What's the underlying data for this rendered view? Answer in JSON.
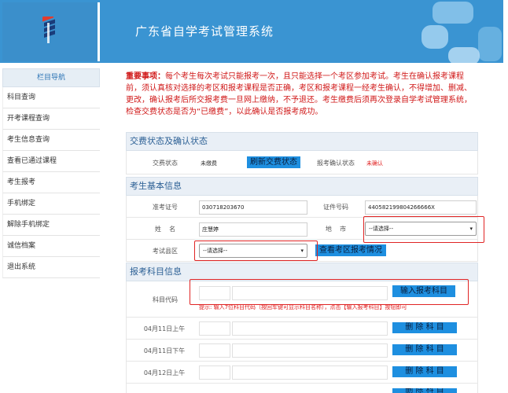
{
  "header": {
    "title": "广东省自学考试管理系统"
  },
  "sidebar": {
    "title": "栏目导航",
    "items": [
      {
        "label": "科目查询"
      },
      {
        "label": "开考课程查询"
      },
      {
        "label": "考生信息查询"
      },
      {
        "label": "查看已通过课程"
      },
      {
        "label": "考生报考"
      },
      {
        "label": "手机绑定"
      },
      {
        "label": "解除手机绑定"
      },
      {
        "label": "诚信档案"
      },
      {
        "label": "退出系统"
      }
    ]
  },
  "notice": {
    "heading": "重要事项：",
    "text": "每个考生每次考试只能报考一次，且只能选择一个考区参加考试。考生在确认报考课程前，须认真核对选择的考区和报考课程是否正确，考区和报考课程一经考生确认，不得增加、删减、更改，确认报考后所交报考费一旦网上缴纳，不予退还。考生缴费后须再次登录自学考试管理系统，检查交费状态是否为“已缴费”，以此确认是否报考成功。"
  },
  "payment": {
    "section_title": "交费状态及确认状态",
    "status_label": "交费状态",
    "status_value": "未缴费",
    "refresh_button": "刷新交费状态",
    "confirm_label": "报考确认状态",
    "confirm_value": "未确认"
  },
  "basic": {
    "section_title": "考生基本信息",
    "exam_no_label": "准考证号",
    "exam_no_value": "030718203670",
    "id_label": "证件号码",
    "id_value": "440582199804266666X",
    "name_label": "姓    名",
    "name_value": "庄慧婷",
    "city_label": "地    市",
    "city_placeholder": "--请选择--",
    "district_label": "考试县区",
    "district_placeholder": "--请选择--",
    "view_district_button": "查看考区报考情况"
  },
  "subjects": {
    "section_title": "报考科目信息",
    "code_label": "科目代码",
    "input_button": "输入报考科目",
    "hint": "提示: 输入7位科目代码（按回车键可显示科目名称），点击【输入报考科目】按钮即可",
    "rows": [
      {
        "label": "04月11日上午",
        "delete_button": "删 除 科 目"
      },
      {
        "label": "04月11日下午",
        "delete_button": "删 除 科 目"
      },
      {
        "label": "04月12日上午",
        "delete_button": "删 除 科 目"
      },
      {
        "label": "04月12日下午",
        "delete_button": "删 除 科 目"
      }
    ]
  }
}
